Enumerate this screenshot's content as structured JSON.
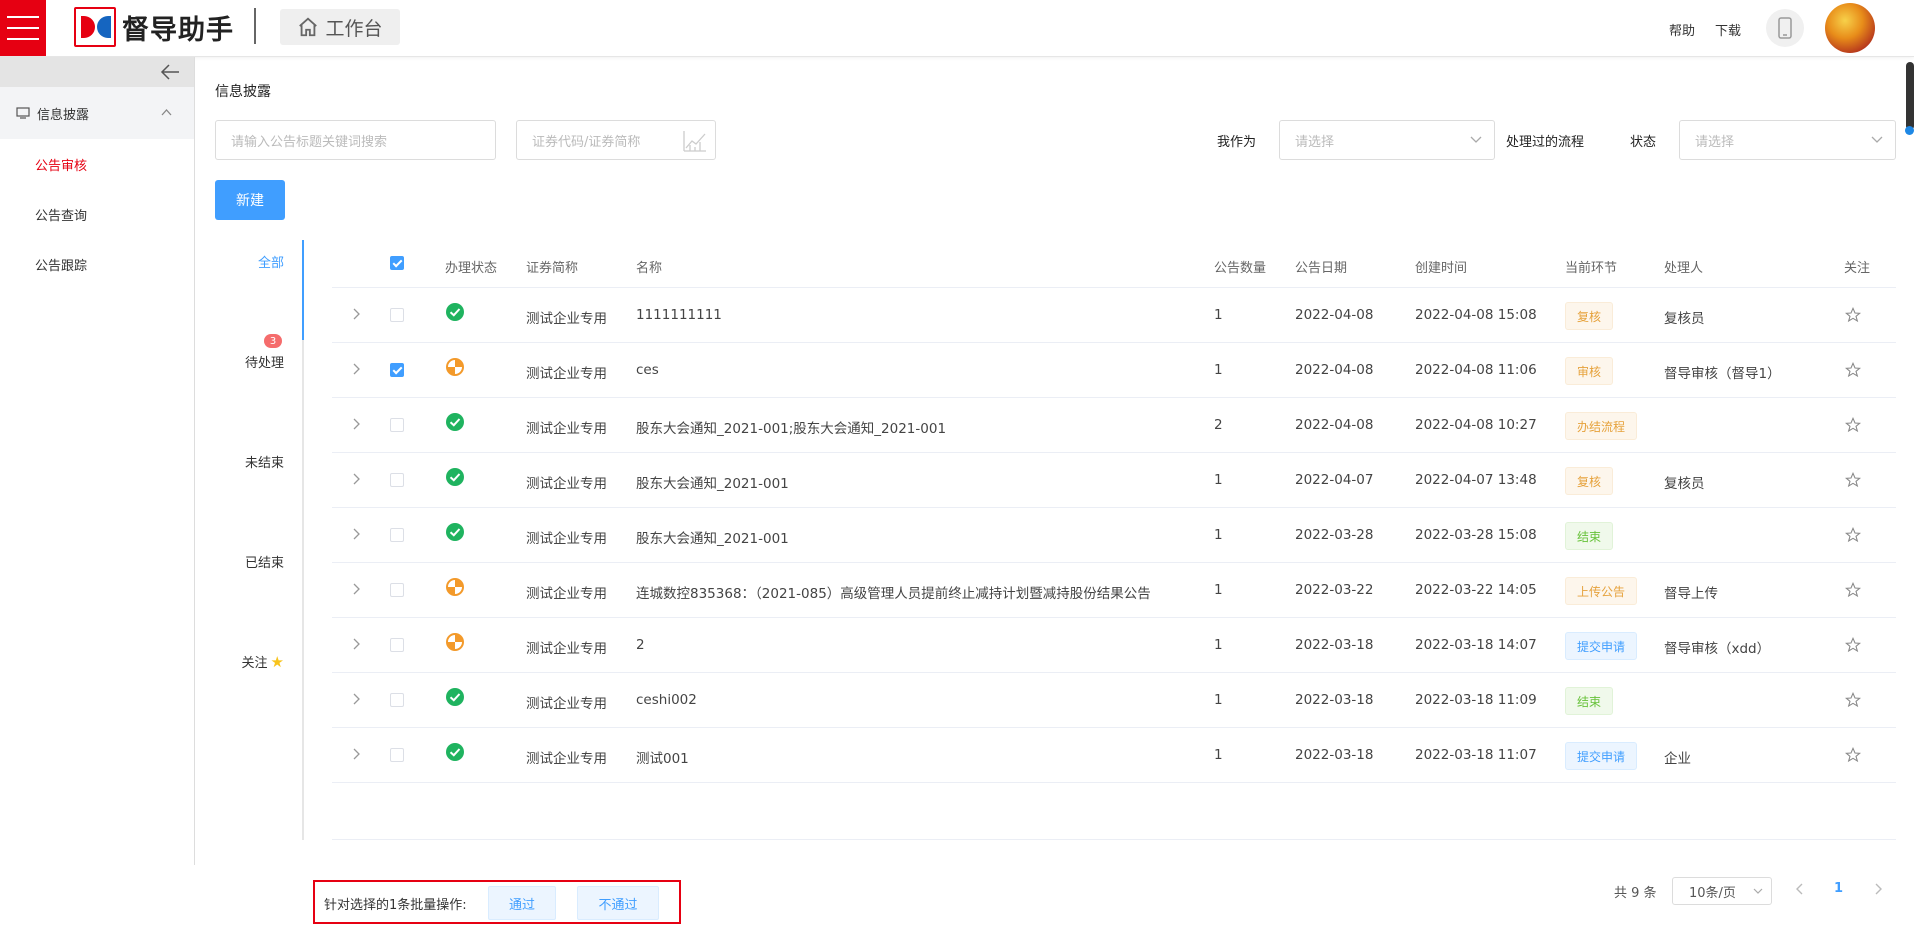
{
  "header": {
    "app_name": "督导助手",
    "workbench_label": "工作台",
    "help_label": "帮助",
    "download_label": "下载",
    "accent_color": "#e60012"
  },
  "sidebar": {
    "group_label": "信息披露",
    "items": [
      {
        "label": "公告审核",
        "active": true
      },
      {
        "label": "公告查询",
        "active": false
      },
      {
        "label": "公告跟踪",
        "active": false
      }
    ]
  },
  "main": {
    "title": "信息披露",
    "search_placeholder": "请输入公告标题关键词搜索",
    "code_placeholder": "证券代码/证券简称",
    "role_label": "我作为",
    "role_placeholder": "请选择",
    "processed_label": "处理过的流程",
    "status_label": "状态",
    "status_placeholder": "请选择",
    "new_button": "新建"
  },
  "tabs": {
    "all": "全部",
    "pending": "待处理",
    "pending_count": "3",
    "unfinished": "未结束",
    "finished": "已结束",
    "follow": "关注"
  },
  "table": {
    "headers": {
      "status": "办理状态",
      "short_name": "证券简称",
      "name": "名称",
      "count": "公告数量",
      "date": "公告日期",
      "created": "创建时间",
      "stage": "当前环节",
      "handler": "处理人",
      "follow": "关注"
    },
    "rows": [
      {
        "checked": false,
        "status": "done",
        "short_name": "测试企业专用",
        "name": "1111111111",
        "count": "1",
        "date": "2022-04-08",
        "created": "2022-04-08 15:08",
        "stage": "复核",
        "stage_color": "orange",
        "handler": "复核员"
      },
      {
        "checked": true,
        "status": "progress",
        "short_name": "测试企业专用",
        "name": "ces",
        "count": "1",
        "date": "2022-04-08",
        "created": "2022-04-08 11:06",
        "stage": "审核",
        "stage_color": "orange",
        "handler": "督导审核（督导1）"
      },
      {
        "checked": false,
        "status": "done",
        "short_name": "测试企业专用",
        "name": "股东大会通知_2021-001;股东大会通知_2021-001",
        "count": "2",
        "date": "2022-04-08",
        "created": "2022-04-08 10:27",
        "stage": "办结流程",
        "stage_color": "orange",
        "handler": ""
      },
      {
        "checked": false,
        "status": "done",
        "short_name": "测试企业专用",
        "name": "股东大会通知_2021-001",
        "count": "1",
        "date": "2022-04-07",
        "created": "2022-04-07 13:48",
        "stage": "复核",
        "stage_color": "orange",
        "handler": "复核员"
      },
      {
        "checked": false,
        "status": "done",
        "short_name": "测试企业专用",
        "name": "股东大会通知_2021-001",
        "count": "1",
        "date": "2022-03-28",
        "created": "2022-03-28 15:08",
        "stage": "结束",
        "stage_color": "green",
        "handler": ""
      },
      {
        "checked": false,
        "status": "progress",
        "short_name": "测试企业专用",
        "name": "连城数控835368：（2021-085）高级管理人员提前终止减持计划暨减持股份结果公告",
        "count": "1",
        "date": "2022-03-22",
        "created": "2022-03-22 14:05",
        "stage": "上传公告",
        "stage_color": "orange",
        "handler": "督导上传"
      },
      {
        "checked": false,
        "status": "progress",
        "short_name": "测试企业专用",
        "name": "2",
        "count": "1",
        "date": "2022-03-18",
        "created": "2022-03-18 14:07",
        "stage": "提交申请",
        "stage_color": "blue",
        "handler": "督导审核（xdd）"
      },
      {
        "checked": false,
        "status": "done",
        "short_name": "测试企业专用",
        "name": "ceshi002",
        "count": "1",
        "date": "2022-03-18",
        "created": "2022-03-18 11:09",
        "stage": "结束",
        "stage_color": "green",
        "handler": ""
      },
      {
        "checked": false,
        "status": "done",
        "short_name": "测试企业专用",
        "name": "测试001",
        "count": "1",
        "date": "2022-03-18",
        "created": "2022-03-18 11:07",
        "stage": "提交申请",
        "stage_color": "blue",
        "handler": "企业"
      }
    ]
  },
  "bulk": {
    "text": "针对选择的1条批量操作:",
    "pass_label": "通过",
    "reject_label": "不通过"
  },
  "pagination": {
    "total": "共 9 条",
    "page_size": "10条/页",
    "current_page": "1"
  }
}
